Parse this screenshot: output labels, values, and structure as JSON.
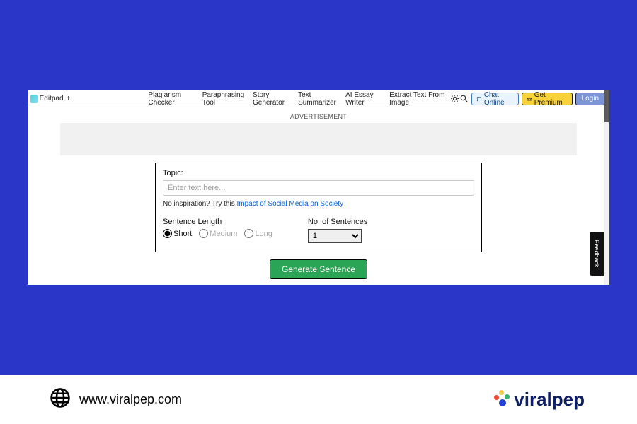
{
  "header": {
    "brand": "Editpad",
    "plus": "+",
    "nav": {
      "plagiarism": "Plagiarism Checker",
      "paraphrase": "Paraphrasing Tool",
      "story": "Story Generator",
      "summarizer": "Text Summarizer",
      "essay": "AI Essay Writer",
      "extract": "Extract Text From Image"
    },
    "chat": "Chat Online",
    "premium": "Get Premium",
    "login": "Login"
  },
  "ad_label": "ADVERTISEMENT",
  "form": {
    "topic_label": "Topic:",
    "topic_placeholder": "Enter text here...",
    "inspire_prefix": "No inspiration? Try this ",
    "inspire_link": "Impact of Social Media on Society",
    "length_label": "Sentence Length",
    "radio": {
      "short": "Short",
      "medium": "Medium",
      "long": "Long"
    },
    "num_label": "No. of Sentences",
    "num_value": "1",
    "generate": "Generate Sentence"
  },
  "feedback": "Feedback",
  "footer": {
    "url": "www.viralpep.com",
    "logo_text": "viralpep"
  }
}
